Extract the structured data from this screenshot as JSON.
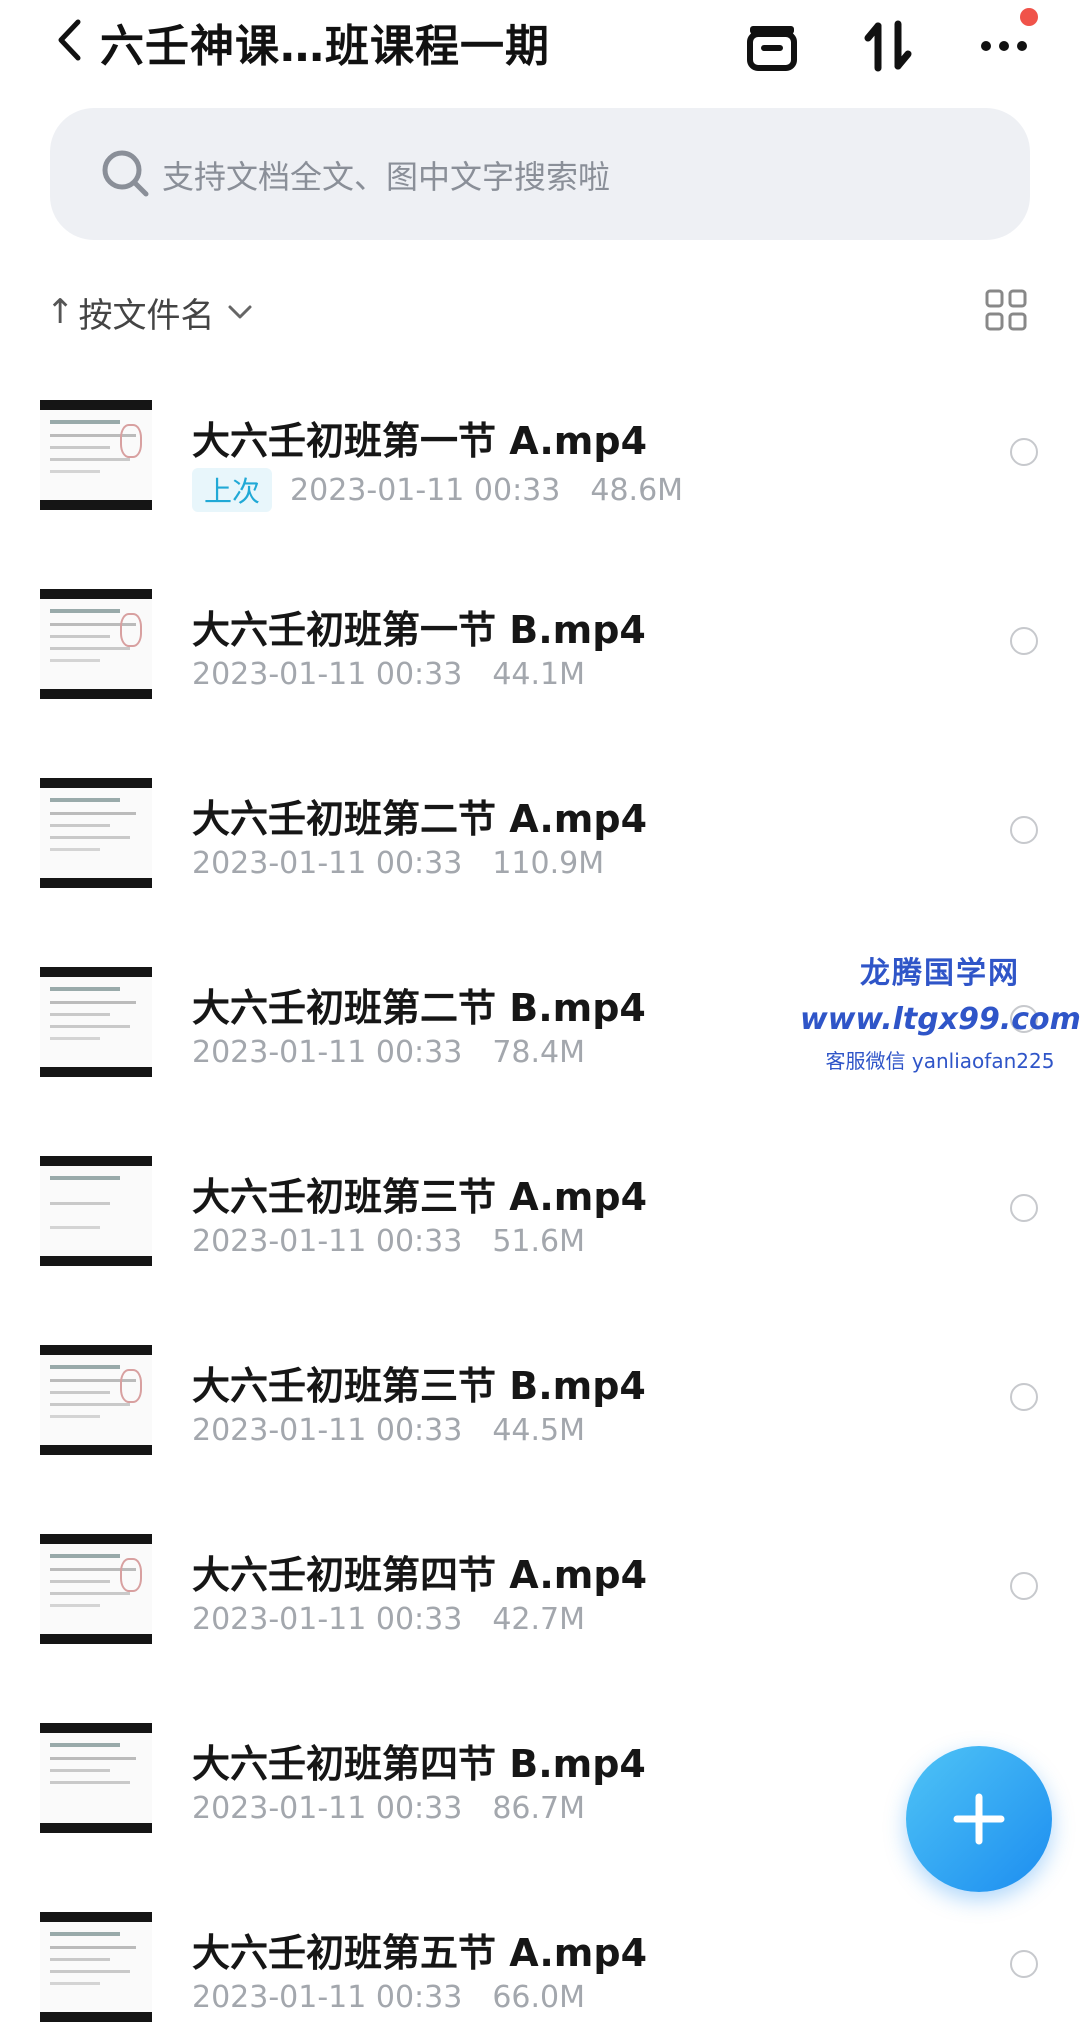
{
  "header": {
    "title": "六壬神课…班课程一期"
  },
  "search": {
    "placeholder": "支持文档全文、图中文字搜索啦"
  },
  "sort": {
    "arrow": "↑",
    "label": "按文件名"
  },
  "files": [
    {
      "name": "大六壬初班第一节 A.mp4",
      "badge": "上次",
      "date": "2023-01-11 00:33",
      "size": "48.6M"
    },
    {
      "name": "大六壬初班第一节 B.mp4",
      "date": "2023-01-11 00:33",
      "size": "44.1M"
    },
    {
      "name": "大六壬初班第二节 A.mp4",
      "date": "2023-01-11 00:33",
      "size": "110.9M"
    },
    {
      "name": "大六壬初班第二节 B.mp4",
      "date": "2023-01-11 00:33",
      "size": "78.4M"
    },
    {
      "name": "大六壬初班第三节 A.mp4",
      "date": "2023-01-11 00:33",
      "size": "51.6M"
    },
    {
      "name": "大六壬初班第三节 B.mp4",
      "date": "2023-01-11 00:33",
      "size": "44.5M"
    },
    {
      "name": "大六壬初班第四节 A.mp4",
      "date": "2023-01-11 00:33",
      "size": "42.7M"
    },
    {
      "name": "大六壬初班第四节 B.mp4",
      "date": "2023-01-11 00:33",
      "size": "86.7M"
    },
    {
      "name": "大六壬初班第五节 A.mp4",
      "date": "2023-01-11 00:33",
      "size": "66.0M"
    }
  ],
  "watermark": {
    "line1": "龙腾国学网",
    "line2": "www.ltgx99.com",
    "line3": "客服微信 yanliaofan225"
  },
  "colors": {
    "accent": "#21a9d6",
    "fab_start": "#4fc4f6",
    "fab_end": "#1c8df0",
    "notification": "#f0534a"
  }
}
